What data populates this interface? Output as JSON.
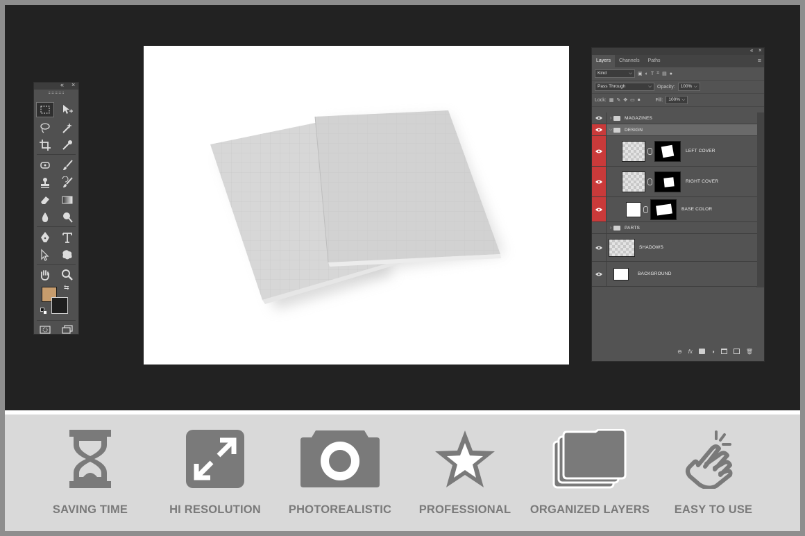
{
  "toolbox": {
    "collapse_glyph": "«",
    "close_glyph": "×",
    "foreground_color": "#c69c6d",
    "background_color": "#1e1e1e",
    "tools": [
      "rectangular-marquee-icon",
      "move-icon",
      "lasso-icon",
      "magic-wand-icon",
      "crop-icon",
      "eyedropper-icon",
      "healing-brush-icon",
      "brush-icon",
      "clone-stamp-icon",
      "history-brush-icon",
      "eraser-icon",
      "gradient-icon",
      "blur-icon",
      "dodge-icon",
      "pen-icon",
      "type-icon",
      "path-selection-icon",
      "custom-shape-icon",
      "hand-icon",
      "zoom-icon",
      "quick-mask-icon",
      "screen-mode-icon"
    ]
  },
  "layers_panel": {
    "collapse_glyph": "«",
    "close_glyph": "×",
    "tabs": [
      "Layers",
      "Channels",
      "Paths"
    ],
    "filter_kind": "Kind",
    "blend_mode": "Pass Through",
    "opacity_label": "Opacity:",
    "opacity_value": "100%",
    "lock_label": "Lock:",
    "fill_label": "Fill:",
    "fill_value": "100%",
    "layers": [
      {
        "name": "MAGAZINES",
        "type": "group",
        "visible": true,
        "highlight": false
      },
      {
        "name": "DESIGN",
        "type": "group",
        "visible": true,
        "highlight": true,
        "expanded": true
      },
      {
        "name": "LEFT COVER",
        "type": "smart",
        "visible": true,
        "highlight": true
      },
      {
        "name": "RIGHT COVER",
        "type": "smart",
        "visible": true,
        "highlight": true
      },
      {
        "name": "BASE COLOR",
        "type": "fill",
        "visible": true,
        "highlight": true
      },
      {
        "name": "PARTS",
        "type": "group",
        "visible": false,
        "highlight": false
      },
      {
        "name": "SHADOWS",
        "type": "pixel",
        "visible": true,
        "highlight": false
      },
      {
        "name": "BACKGROUND",
        "type": "pixel",
        "visible": true,
        "highlight": false
      }
    ],
    "bottom_icons": [
      "link-icon",
      "fx-icon",
      "mask-icon",
      "adjustment-icon",
      "group-icon",
      "new-layer-icon",
      "trash-icon"
    ],
    "fx_label": "fx"
  },
  "features": [
    {
      "label": "SAVING TIME",
      "icon": "hourglass-icon"
    },
    {
      "label": "HI RESOLUTION",
      "icon": "expand-icon"
    },
    {
      "label": "PHOTOREALISTIC",
      "icon": "camera-icon"
    },
    {
      "label": "PROFESSIONAL",
      "icon": "star-icon"
    },
    {
      "label": "ORGANIZED LAYERS",
      "icon": "layers-icon"
    },
    {
      "label": "EASY TO USE",
      "icon": "hand-tap-icon"
    }
  ],
  "colors": {
    "feature_gray": "#7a7a7a",
    "highlight_red": "#c93a3a",
    "workspace": "#222222"
  }
}
